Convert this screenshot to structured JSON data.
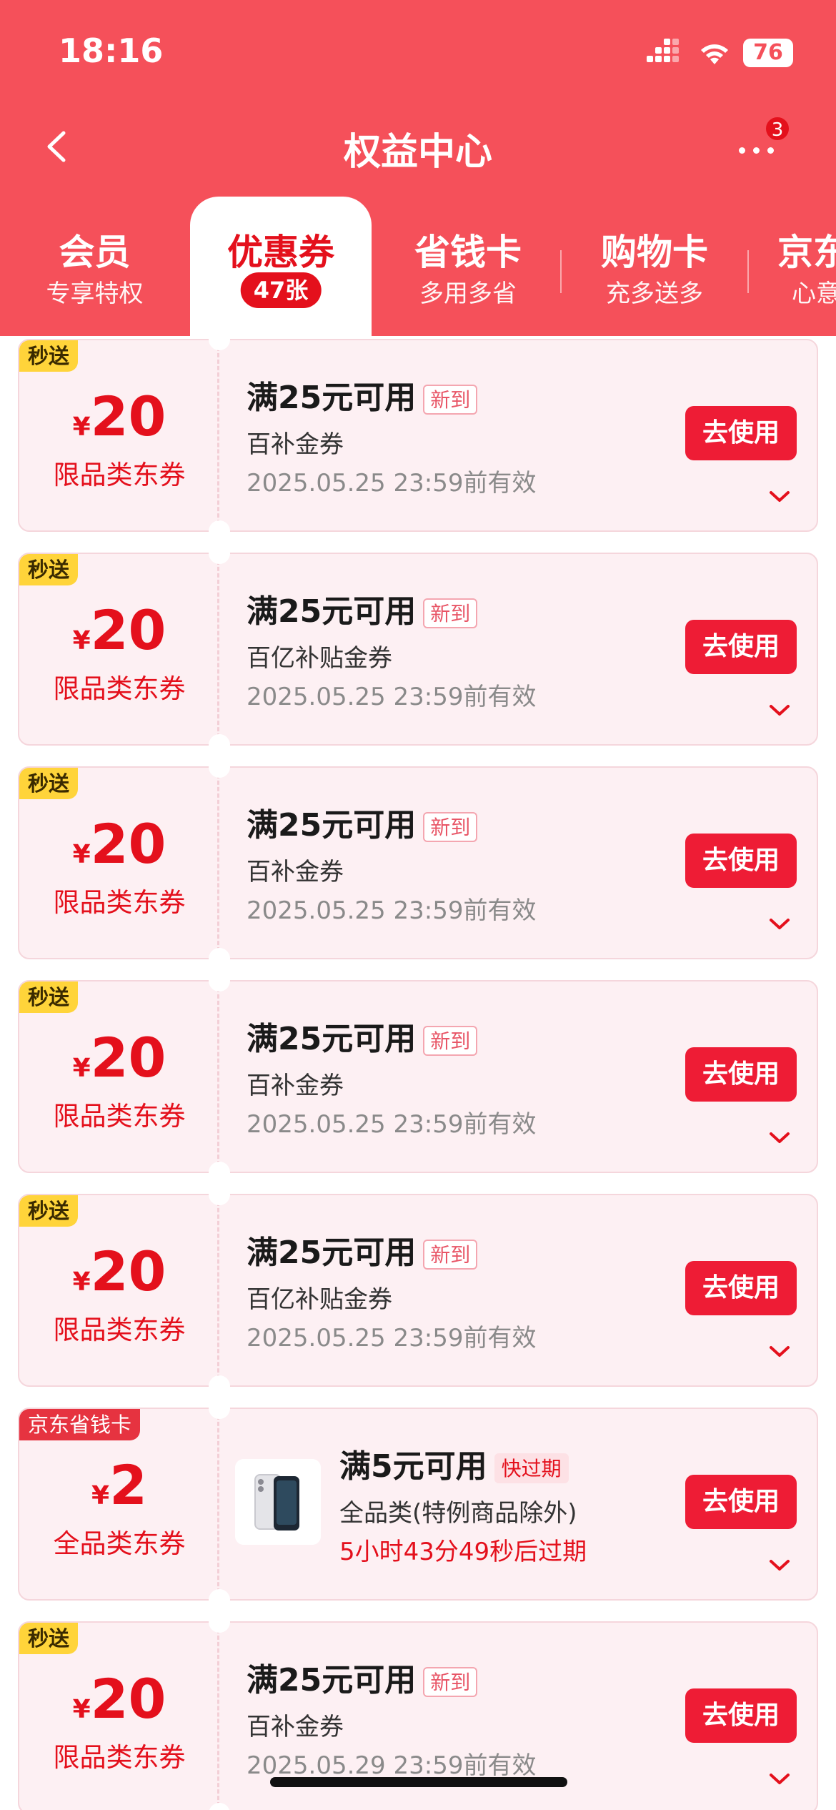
{
  "status_bar": {
    "time": "18:16",
    "battery": "76"
  },
  "nav": {
    "title": "权益中心",
    "badge_count": "3"
  },
  "tabs": [
    {
      "title": "会员",
      "sub": "专享特权"
    },
    {
      "title": "优惠券",
      "count": "47张"
    },
    {
      "title": "省钱卡",
      "sub": "多用多省"
    },
    {
      "title": "购物卡",
      "sub": "充多送多"
    },
    {
      "title": "京东",
      "sub": "心意"
    }
  ],
  "coupons": [
    {
      "tag": "秒送",
      "currency": "¥",
      "amount": "20",
      "limit": "限品类东券",
      "condition": "满25元可用",
      "label": "新到",
      "name": "百补金券",
      "expiry": "2025.05.25 23:59前有效",
      "button": "去使用"
    },
    {
      "tag": "秒送",
      "currency": "¥",
      "amount": "20",
      "limit": "限品类东券",
      "condition": "满25元可用",
      "label": "新到",
      "name": "百亿补贴金券",
      "expiry": "2025.05.25 23:59前有效",
      "button": "去使用"
    },
    {
      "tag": "秒送",
      "currency": "¥",
      "amount": "20",
      "limit": "限品类东券",
      "condition": "满25元可用",
      "label": "新到",
      "name": "百补金券",
      "expiry": "2025.05.25 23:59前有效",
      "button": "去使用"
    },
    {
      "tag": "秒送",
      "currency": "¥",
      "amount": "20",
      "limit": "限品类东券",
      "condition": "满25元可用",
      "label": "新到",
      "name": "百补金券",
      "expiry": "2025.05.25 23:59前有效",
      "button": "去使用"
    },
    {
      "tag": "秒送",
      "currency": "¥",
      "amount": "20",
      "limit": "限品类东券",
      "condition": "满25元可用",
      "label": "新到",
      "name": "百亿补贴金券",
      "expiry": "2025.05.25 23:59前有效",
      "button": "去使用"
    },
    {
      "tag": "京东省钱卡",
      "currency": "¥",
      "amount": "2",
      "limit": "全品类东券",
      "condition": "满5元可用",
      "label": "快过期",
      "name": "全品类(特例商品除外)",
      "expiry": "5小时43分49秒后过期",
      "button": "去使用"
    },
    {
      "tag": "秒送",
      "currency": "¥",
      "amount": "20",
      "limit": "限品类东券",
      "condition": "满25元可用",
      "label": "新到",
      "name": "百补金券",
      "expiry": "2025.05.29 23:59前有效",
      "button": "去使用"
    }
  ],
  "colors": {
    "brand": "#f5505a",
    "accent": "#e4101c",
    "button": "#ee1c35",
    "tag_yellow": "#ffd43a"
  }
}
